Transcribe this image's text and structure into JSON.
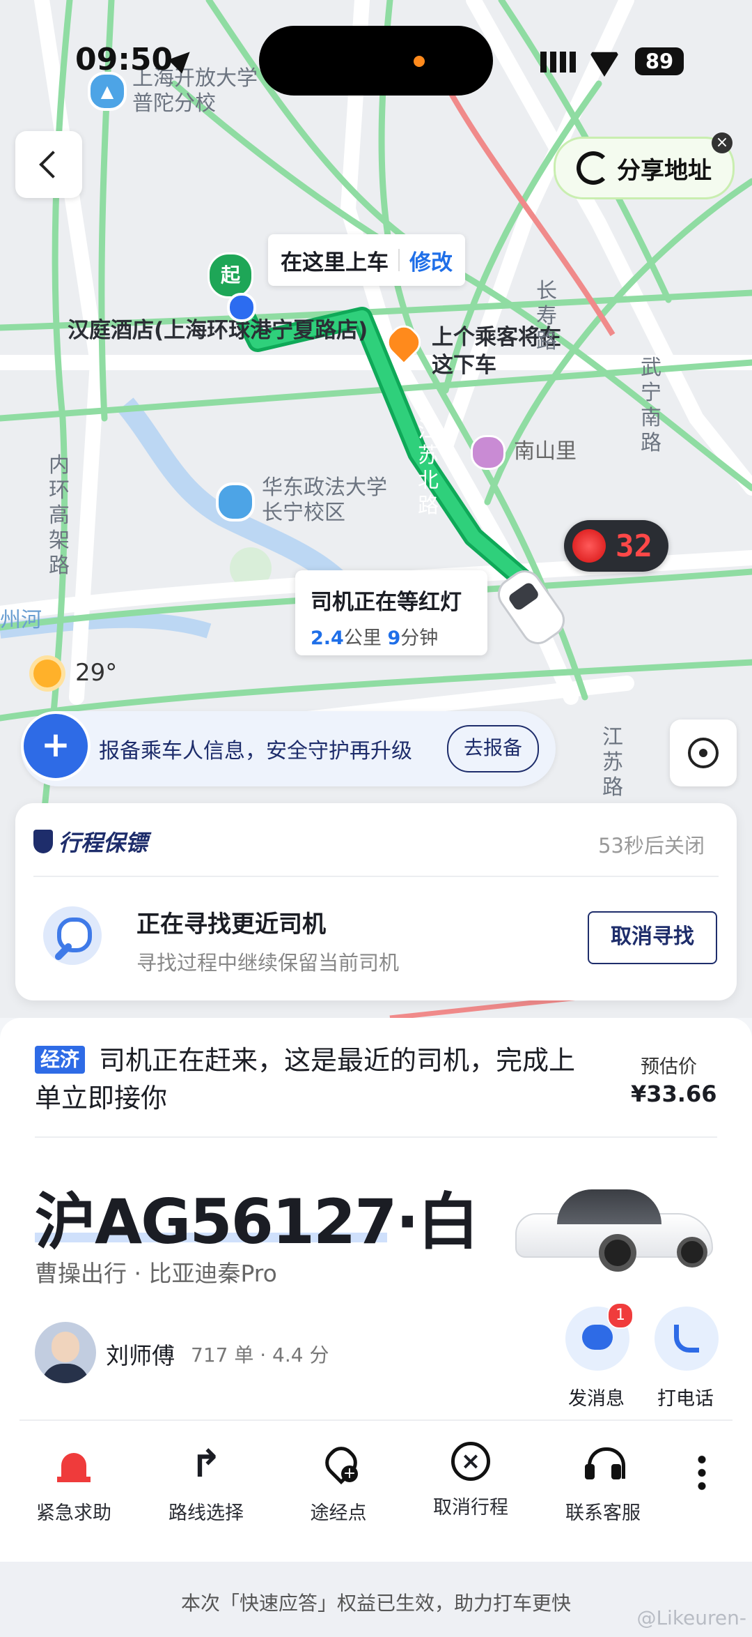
{
  "status_bar": {
    "time": "09:50",
    "battery": "89"
  },
  "map": {
    "labels": {
      "school_top": "上海开放大学\n普陀分校",
      "hotel": "汉庭酒店(上海环球港宁夏路店)",
      "prev_passenger": "上个乘客将在\n这下车",
      "nanshan": "南山里",
      "ecupl": "华东政法大学\n长宁校区",
      "inner_ring": "内环高架路",
      "changshou": "长寿路",
      "wuning": "武宁南路",
      "jiangsu_road_1": "江苏北路",
      "jiangsu_road_2": "江苏路",
      "river": "州河",
      "start_marker": "起"
    },
    "pickup_bubble": {
      "text": "在这里上车",
      "action": "修改"
    },
    "share_button": "分享地址",
    "traffic_light_seconds": "32",
    "driver_bubble": {
      "title": "司机正在等红灯",
      "distance": "2.4",
      "distance_unit": "公里",
      "minutes": "9",
      "minutes_unit": "分钟"
    },
    "weather": {
      "temp": "29°"
    },
    "safety_banner": {
      "text": "报备乘车人信息，安全守护再升级",
      "button": "去报备"
    }
  },
  "trip_card": {
    "brand": "行程保镖",
    "countdown": "53秒后关闭",
    "title": "正在寻找更近司机",
    "subtitle": "寻找过程中继续保留当前司机",
    "button": "取消寻找"
  },
  "sheet": {
    "tag": "经济",
    "status": "司机正在赶来，这是最近的司机，完成上单立即接你",
    "price_label": "预估价",
    "price": "¥33.66",
    "plate": "沪AG56127·白",
    "car_desc": "曹操出行 · 比亚迪秦Pro",
    "driver_name": "刘师傅",
    "driver_stats": "717 单 · 4.4 分",
    "message_label": "发消息",
    "message_badge": "1",
    "call_label": "打电话",
    "actions": [
      {
        "label": "紧急求助",
        "icon": "alarm-icon"
      },
      {
        "label": "路线选择",
        "icon": "route-icon"
      },
      {
        "label": "途经点",
        "icon": "waypoint-add-icon"
      },
      {
        "label": "取消行程",
        "icon": "cancel-circle-icon"
      },
      {
        "label": "联系客服",
        "icon": "headset-icon"
      }
    ]
  },
  "footer": {
    "text": "本次「快速应答」权益已生效，助力打车更快",
    "watermark": "@Likeuren-"
  },
  "colors": {
    "accent": "#1f6fe8",
    "route": "#16b862",
    "danger": "#ef3b3b",
    "navy": "#1e2d6b"
  }
}
